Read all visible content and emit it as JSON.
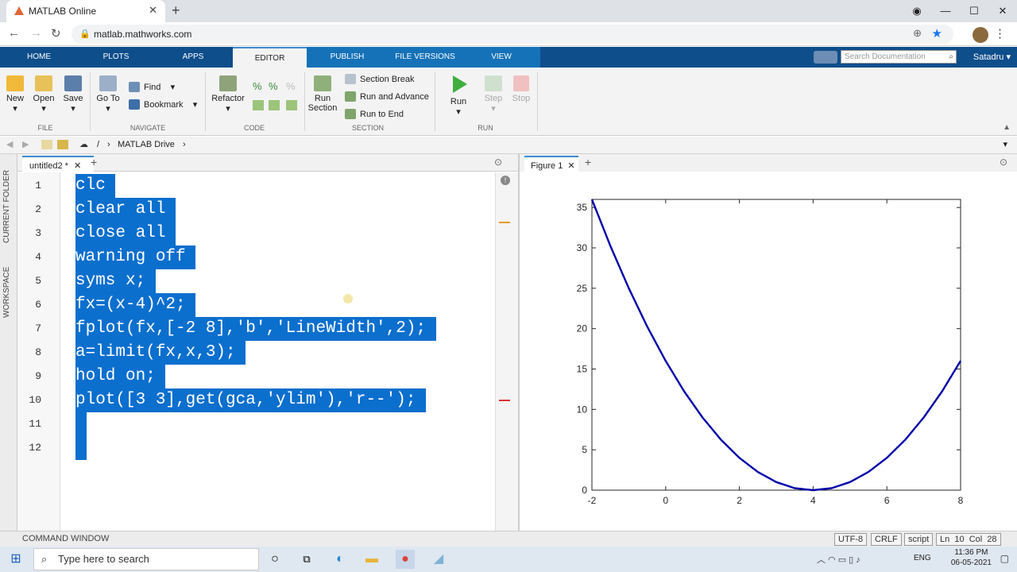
{
  "browser": {
    "tab_title": "MATLAB Online",
    "url": "matlab.mathworks.com"
  },
  "matlab": {
    "tabs": [
      "HOME",
      "PLOTS",
      "APPS",
      "EDITOR",
      "PUBLISH",
      "FILE VERSIONS",
      "VIEW"
    ],
    "search_placeholder": "Search Documentation",
    "user": "Satadru",
    "file": {
      "new": "New",
      "open": "Open",
      "save": "Save",
      "label": "FILE"
    },
    "navigate": {
      "goto": "Go To",
      "find": "Find",
      "bookmark": "Bookmark",
      "label": "NAVIGATE"
    },
    "code": {
      "refactor": "Refactor",
      "label": "CODE"
    },
    "section": {
      "run_section_1": "Run",
      "run_section_2": "Section",
      "section_break": "Section Break",
      "run_and_advance": "Run and Advance",
      "run_to_end": "Run to End",
      "label": "SECTION"
    },
    "run": {
      "run": "Run",
      "step": "Step",
      "stop": "Stop",
      "label": "RUN"
    },
    "path": {
      "root": "/",
      "folder": "MATLAB Drive"
    },
    "side": {
      "current_folder": "CURRENT FOLDER",
      "workspace": "WORKSPACE"
    },
    "editor": {
      "tab": "untitled2 *",
      "lines": [
        "clc",
        "clear all",
        "close all",
        "warning off",
        "syms x;",
        "fx=(x-4)^2;",
        "fplot(fx,[-2 8],'b','LineWidth',2);",
        "a=limit(fx,x,3);",
        "hold on;",
        "plot([3 3],get(gca,'ylim'),'r--');",
        "",
        ""
      ],
      "line_numbers": [
        "1",
        "2",
        "3",
        "4",
        "5",
        "6",
        "7",
        "8",
        "9",
        "10",
        "11",
        "12"
      ]
    },
    "figure_tab": "Figure 1",
    "command_window": "COMMAND WINDOW",
    "status": {
      "encoding": "UTF-8",
      "eol": "CRLF",
      "mode": "script",
      "position": "Ln  10  Col  28"
    }
  },
  "taskbar": {
    "search": "Type here to search",
    "lang": "ENG",
    "time": "11:36 PM",
    "date": "06-05-2021"
  },
  "colors": {
    "matlab_blue": "#0e4e8b",
    "selection": "#0b6fce",
    "curve": "#0000aa"
  },
  "chart_data": {
    "type": "line",
    "x": [
      -2,
      -1.5,
      -1,
      -0.5,
      0,
      0.5,
      1,
      1.5,
      2,
      2.5,
      3,
      3.5,
      4,
      4.5,
      5,
      5.5,
      6,
      6.5,
      7,
      7.5,
      8
    ],
    "y": [
      36,
      30.25,
      25,
      20.25,
      16,
      12.25,
      9,
      6.25,
      4,
      2.25,
      1,
      0.25,
      0,
      0.25,
      1,
      2.25,
      4,
      6.25,
      9,
      12.25,
      16
    ],
    "xlim": [
      -2,
      8
    ],
    "ylim": [
      0,
      36
    ],
    "xticks": [
      "-2",
      "0",
      "2",
      "4",
      "6",
      "8"
    ],
    "yticks": [
      "0",
      "5",
      "10",
      "15",
      "20",
      "25",
      "30",
      "35"
    ],
    "xtick_values": [
      -2,
      0,
      2,
      4,
      6,
      8
    ],
    "ytick_values": [
      0,
      5,
      10,
      15,
      20,
      25,
      30,
      35
    ],
    "grid": false,
    "title": "",
    "xlabel": "",
    "ylabel": ""
  }
}
